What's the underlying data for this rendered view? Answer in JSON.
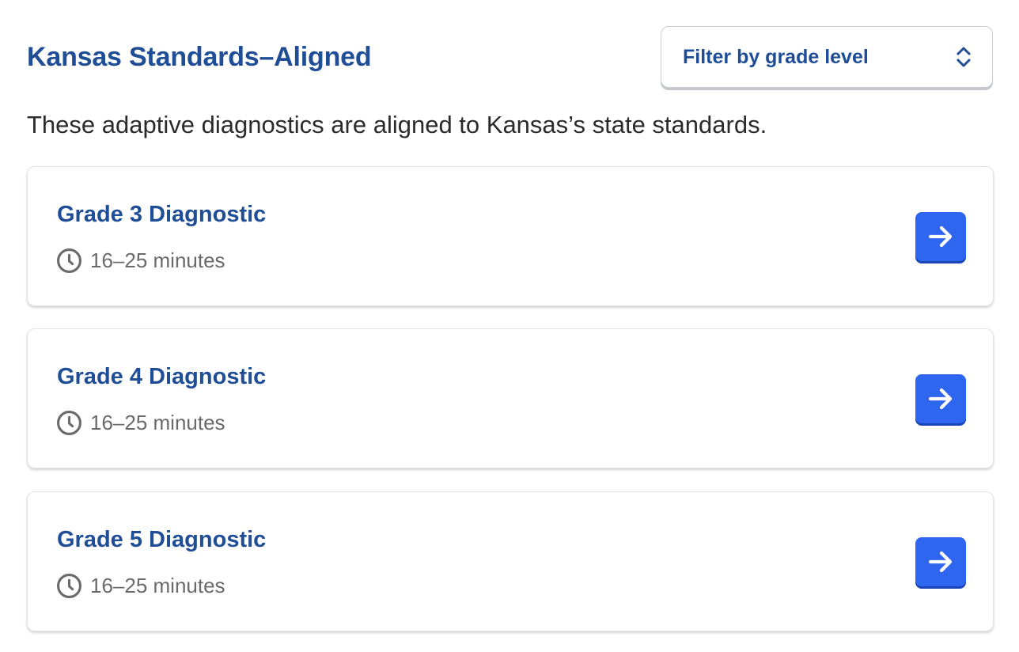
{
  "section": {
    "title": "Kansas Standards–Aligned",
    "description": "These adaptive diagnostics are aligned to Kansas’s state standards."
  },
  "filter": {
    "label": "Filter by grade level",
    "icon": "chevron-up-down-icon"
  },
  "diagnostics": [
    {
      "title": "Grade 3 Diagnostic",
      "duration": "16–25 minutes",
      "icon": "clock-icon",
      "action_icon": "arrow-right-icon"
    },
    {
      "title": "Grade 4 Diagnostic",
      "duration": "16–25 minutes",
      "icon": "clock-icon",
      "action_icon": "arrow-right-icon"
    },
    {
      "title": "Grade 5 Diagnostic",
      "duration": "16–25 minutes",
      "icon": "clock-icon",
      "action_icon": "arrow-right-icon"
    }
  ],
  "colors": {
    "heading": "#1f4e96",
    "accent_button": "#2f66f0",
    "body_text": "#2b2b2b",
    "muted_text": "#6a6a6a"
  }
}
